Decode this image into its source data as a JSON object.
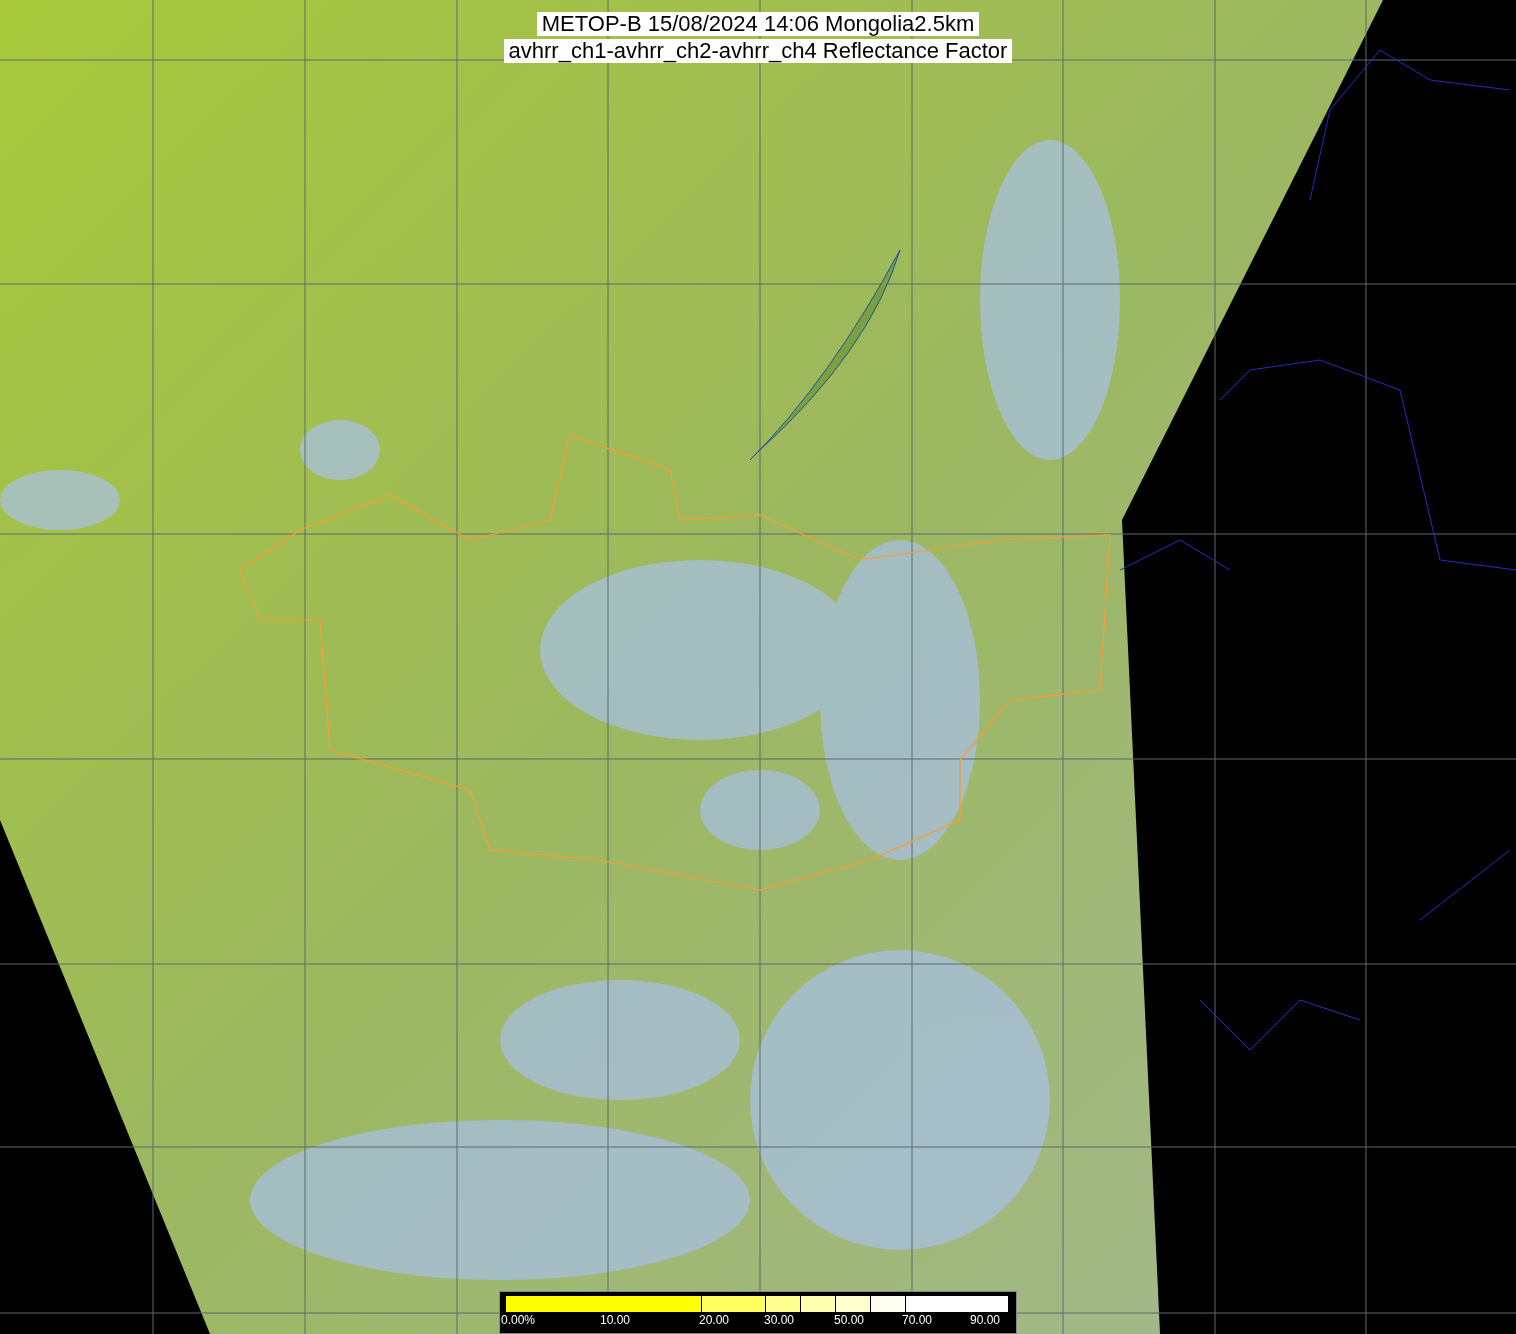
{
  "title": {
    "lines": [
      "METOP-B 15/08/2024 14:06 Mongolia2.5km",
      "avhrr_ch1-avhrr_ch2-avhrr_ch4 Reflectance Factor"
    ]
  },
  "colorbar": {
    "bands": [
      {
        "color": "#ffff00"
      },
      {
        "color": "#ffff60"
      },
      {
        "color": "#ffff90"
      },
      {
        "color": "#ffffb0"
      },
      {
        "color": "#ffffd0"
      },
      {
        "color": "#fffff0"
      },
      {
        "color": "#ffffff"
      }
    ],
    "labels": [
      "0.00%",
      "10.00",
      "20.00",
      "30.00",
      "50.00",
      "70.00",
      "90.00"
    ]
  }
}
